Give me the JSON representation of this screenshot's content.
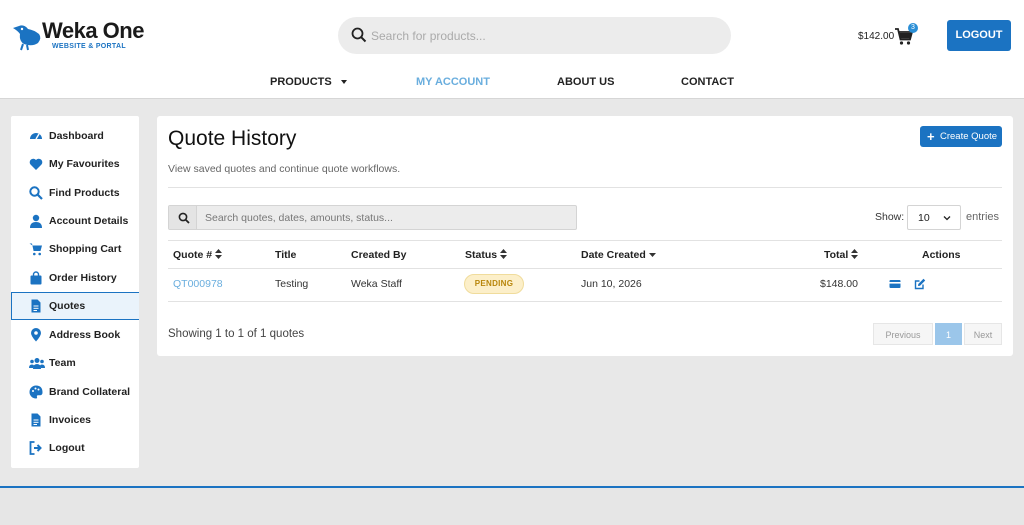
{
  "brand": {
    "name": "Weka One",
    "tagline": "WEBSITE & PORTAL"
  },
  "search": {
    "placeholder": "Search for products..."
  },
  "cart": {
    "total": "$142.00",
    "count": "3"
  },
  "header": {
    "logout_label": "LOGOUT"
  },
  "nav": [
    {
      "label": "PRODUCTS",
      "has_dropdown": true
    },
    {
      "label": "MY ACCOUNT",
      "active": true
    },
    {
      "label": "ABOUT US"
    },
    {
      "label": "CONTACT"
    }
  ],
  "sidebar": {
    "items": [
      {
        "label": "Dashboard",
        "icon": "dashboard-icon"
      },
      {
        "label": "My Favourites",
        "icon": "heart-icon"
      },
      {
        "label": "Find Products",
        "icon": "search-icon"
      },
      {
        "label": "Account Details",
        "icon": "user-icon"
      },
      {
        "label": "Shopping Cart",
        "icon": "cart-icon"
      },
      {
        "label": "Order History",
        "icon": "bag-icon"
      },
      {
        "label": "Quotes",
        "icon": "document-icon",
        "active": true
      },
      {
        "label": "Address Book",
        "icon": "map-pin-icon"
      },
      {
        "label": "Team",
        "icon": "team-icon"
      },
      {
        "label": "Brand Collateral",
        "icon": "palette-icon"
      },
      {
        "label": "Invoices",
        "icon": "invoice-icon"
      },
      {
        "label": "Logout",
        "icon": "logout-icon"
      }
    ]
  },
  "main": {
    "title": "Quote History",
    "description": "View saved quotes and continue quote workflows.",
    "create_label": "Create Quote",
    "table_search_placeholder": "Search quotes, dates, amounts, status...",
    "show_label": "Show:",
    "page_size": "10",
    "entries_label": "entries",
    "columns": [
      "Quote #",
      "Title",
      "Created By",
      "Status",
      "Date Created",
      "Total",
      "Actions"
    ],
    "rows": [
      {
        "quote": "QT000978",
        "title": "Testing",
        "created_by": "Weka Staff",
        "status": "PENDING",
        "date": "Jun 10, 2026",
        "total": "$148.00"
      }
    ],
    "info": "Showing 1 to 1 of 1 quotes",
    "pagination": {
      "previous": "Previous",
      "current": "1",
      "next": "Next"
    }
  },
  "colors": {
    "accent": "#1b73c2",
    "link": "#6aaede",
    "pending_bg": "#fcefc9",
    "pending_text": "#b8860b"
  }
}
